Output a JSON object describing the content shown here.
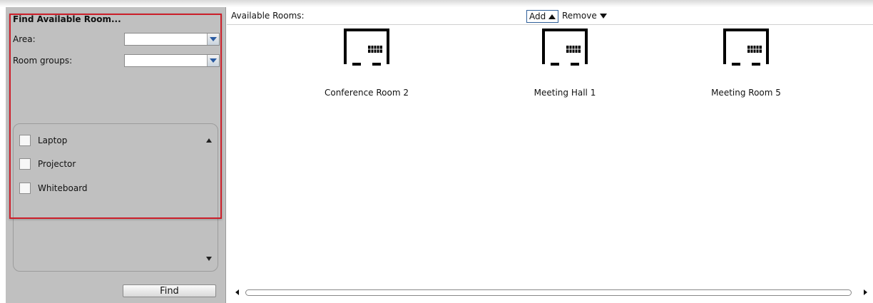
{
  "find_panel": {
    "title": "Find Available Room...",
    "area_label": "Area:",
    "area_value": "",
    "room_groups_label": "Room groups:",
    "room_groups_value": "",
    "features": [
      {
        "label": "Laptop",
        "checked": false
      },
      {
        "label": "Projector",
        "checked": false
      },
      {
        "label": "Whiteboard",
        "checked": false
      }
    ],
    "find_button_label": "Find"
  },
  "rooms_panel": {
    "title": "Available Rooms:",
    "add_label": "Add",
    "remove_label": "Remove",
    "rooms": [
      {
        "name": "Conference Room 2",
        "icon": "door-keypad-icon"
      },
      {
        "name": "Meeting Hall 1",
        "icon": "door-keypad-icon"
      },
      {
        "name": "Meeting Room 5",
        "icon": "door-keypad-icon"
      }
    ]
  },
  "annotation": {
    "highlight_color": "#cc1f2a",
    "arrow_color": "#cc1f2a"
  }
}
